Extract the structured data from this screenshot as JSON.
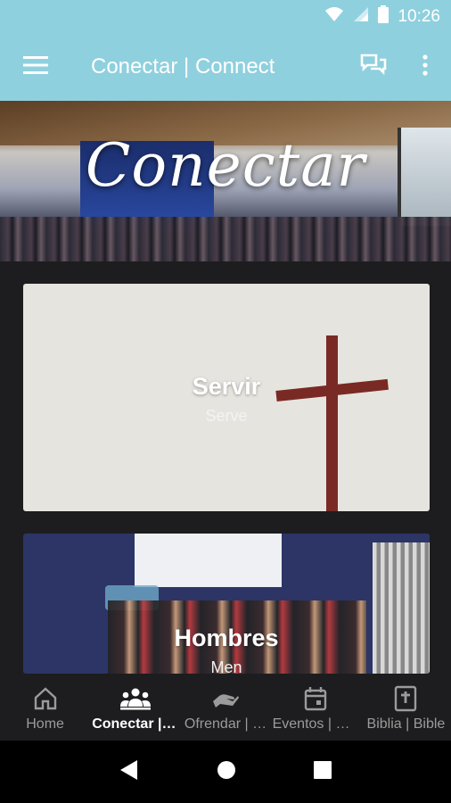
{
  "status_bar": {
    "time": "10:26"
  },
  "app_bar": {
    "title": "Conectar | Connect"
  },
  "hero": {
    "title": "Conectar"
  },
  "cards": [
    {
      "title": "Servir",
      "subtitle": "Serve"
    },
    {
      "title": "Hombres",
      "subtitle": "Men"
    }
  ],
  "bottom_nav": {
    "items": [
      {
        "label": "Home",
        "icon": "home-icon"
      },
      {
        "label": "Conectar | …",
        "icon": "groups-icon"
      },
      {
        "label": "Ofrendar | …",
        "icon": "giving-hand-icon"
      },
      {
        "label": "Eventos | Ev…",
        "icon": "calendar-icon"
      },
      {
        "label": "Biblia | Bible",
        "icon": "bible-icon"
      }
    ]
  },
  "colors": {
    "app_bar": "#8fd0de",
    "background": "#1d1d1f",
    "cross": "#7a2a24"
  }
}
